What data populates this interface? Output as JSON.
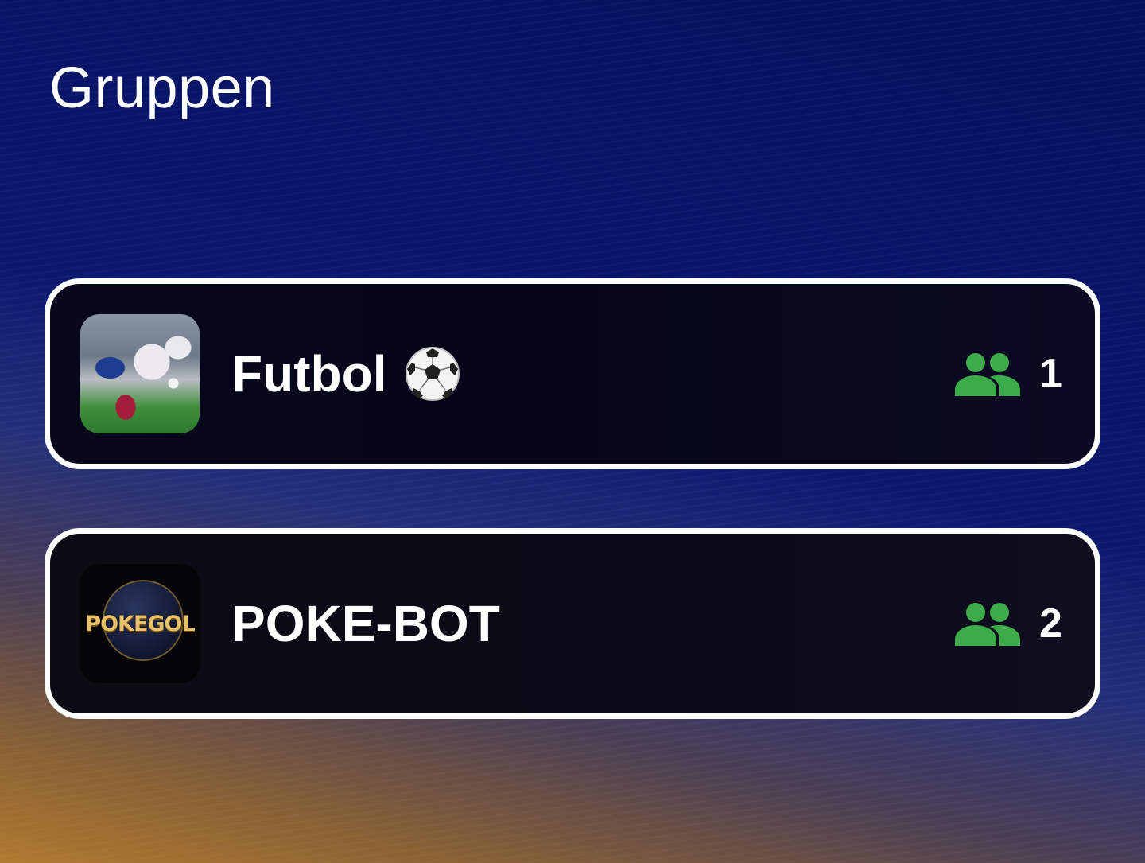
{
  "header": {
    "title": "Gruppen"
  },
  "groups": [
    {
      "name": "Futbol",
      "emoji_icon": "soccer-ball-icon",
      "avatar": "football-match-photo",
      "member_count": "1",
      "member_icon": "people-icon"
    },
    {
      "name": "POKE-BOT",
      "avatar": "pokegol-logo",
      "avatar_text": "POKEGOL",
      "member_count": "2",
      "member_icon": "people-icon"
    }
  ],
  "colors": {
    "accent_green": "#3cab4a",
    "card_border": "#ffffff",
    "text": "#ffffff"
  }
}
